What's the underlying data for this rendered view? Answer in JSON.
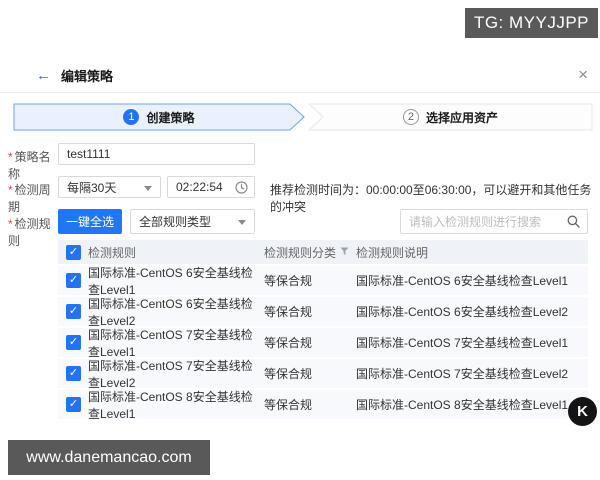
{
  "overlays": {
    "tg_badge": "TG: MYYJJPP",
    "site_watermark": "www.danemancao.com",
    "logo_letter": "K"
  },
  "header": {
    "back_icon": "←",
    "title": "编辑策略",
    "close_icon": "×"
  },
  "wizard": {
    "steps": [
      {
        "number": "1",
        "label": "创建策略",
        "active": true
      },
      {
        "number": "2",
        "label": "选择应用资产",
        "active": false
      }
    ]
  },
  "form": {
    "required_marker": "*",
    "policy_name": {
      "label": "策略名称",
      "value": "test1111"
    },
    "detection_cycle": {
      "label": "检测周期",
      "interval_value": "每隔30天",
      "time_value": "02:22:54",
      "hint": "推荐检测时间为：00:00:00至06:30:00，可以避开和其他任务的冲突"
    },
    "detection_rules": {
      "label": "检测规则",
      "select_all_button": "一键全选",
      "rule_type_value": "全部规则类型",
      "search_placeholder": "请输入检测规则进行搜索"
    }
  },
  "table": {
    "check_glyph": "✓",
    "columns": {
      "rule": "检测规则",
      "category": "检测规则分类",
      "description": "检测规则说明"
    },
    "rows": [
      {
        "rule": "国际标准-CentOS 6安全基线检查Level1",
        "category": "等保合规",
        "description": "国际标准-CentOS 6安全基线检查Level1"
      },
      {
        "rule": "国际标准-CentOS 6安全基线检查Level2",
        "category": "等保合规",
        "description": "国际标准-CentOS 6安全基线检查Level2"
      },
      {
        "rule": "国际标准-CentOS 7安全基线检查Level1",
        "category": "等保合规",
        "description": "国际标准-CentOS 7安全基线检查Level1"
      },
      {
        "rule": "国际标准-CentOS 7安全基线检查Level2",
        "category": "等保合规",
        "description": "国际标准-CentOS 7安全基线检查Level2"
      },
      {
        "rule": "国际标准-CentOS 8安全基线检查Level1",
        "category": "等保合规",
        "description": "国际标准-CentOS 8安全基线检查Level1"
      }
    ]
  },
  "colors": {
    "accent_blue": "#2272F2",
    "step_active_bg": "#E8F1FC",
    "step_active_border": "#6EA3EE",
    "step_inactive_border": "#E4E7EB",
    "table_header_bg": "#EFF2F6",
    "row_bg": "#F7F9FC",
    "watermark_bg": "#595959",
    "required_red": "#E54545"
  }
}
